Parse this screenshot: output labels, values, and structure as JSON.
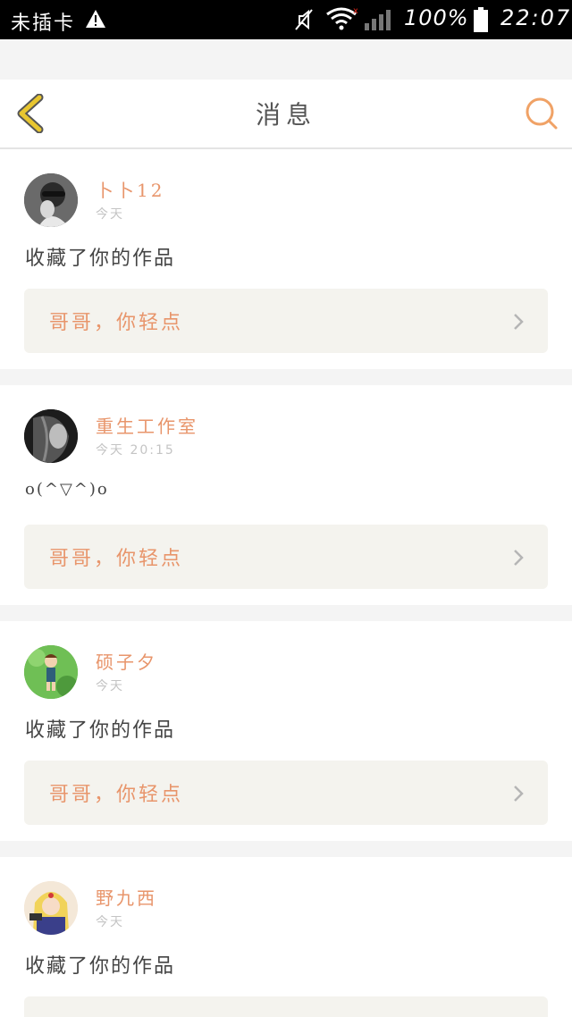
{
  "status_bar": {
    "carrier": "未插卡",
    "battery_percent": "100%",
    "time": "22:07",
    "icons": [
      "warning-icon",
      "mute-icon",
      "wifi-icon",
      "signal-icon",
      "battery-icon"
    ]
  },
  "header": {
    "title": "消息",
    "back_icon": "chevron-left-icon",
    "search_icon": "search-icon"
  },
  "colors": {
    "accent": "#e8956b",
    "back_icon": "#e8c630",
    "work_row_bg": "#f4f3ee"
  },
  "messages": [
    {
      "name": "卜卜12",
      "time": "今天",
      "text": "收藏了你的作品",
      "work_title": "哥哥，你轻点"
    },
    {
      "name": "重生工作室",
      "time": "今天  20:15",
      "text": "o(^▽^)o",
      "work_title": "哥哥，你轻点"
    },
    {
      "name": "硕子夕",
      "time": "今天",
      "text": "收藏了你的作品",
      "work_title": "哥哥，你轻点"
    },
    {
      "name": "野九西",
      "time": "今天",
      "text": "收藏了你的作品",
      "work_title": ""
    }
  ]
}
